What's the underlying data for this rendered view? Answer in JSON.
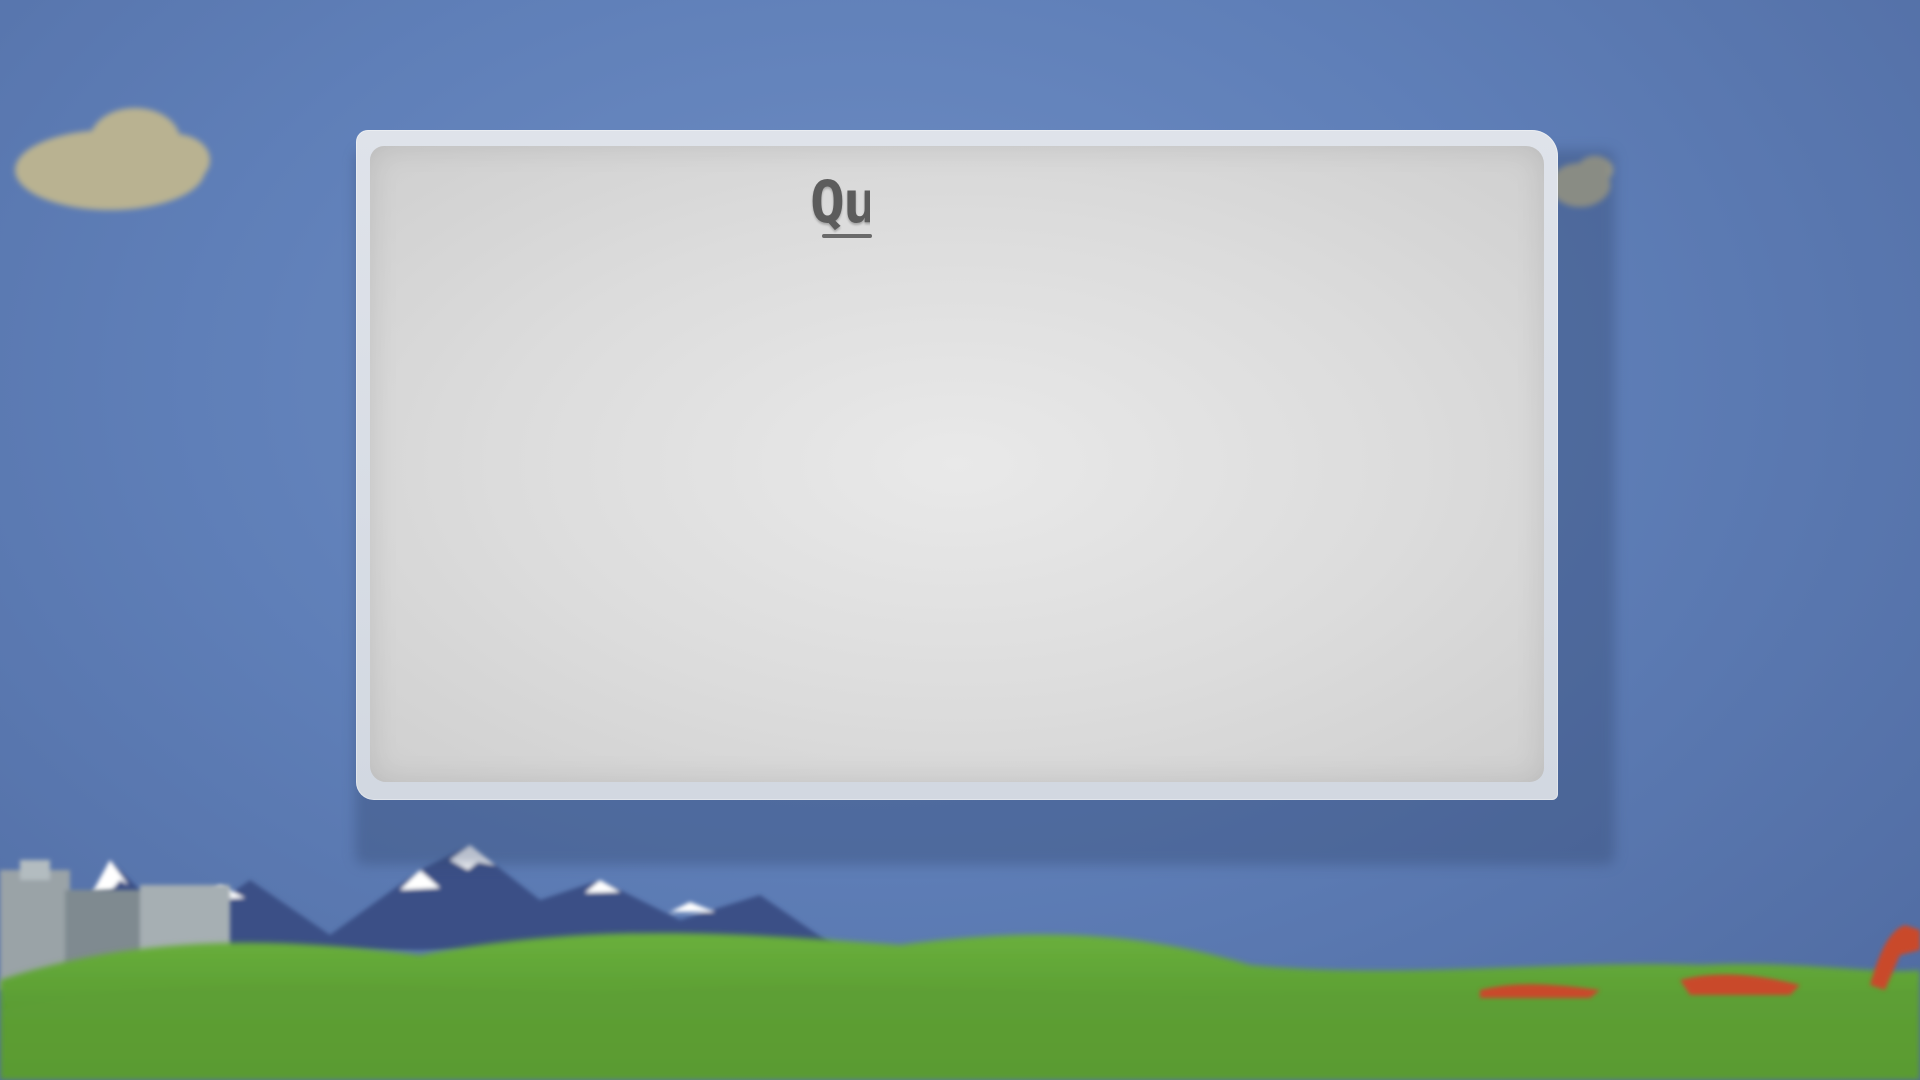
{
  "card": {
    "title": "Qu"
  },
  "colors": {
    "sky": "#5f7fb8",
    "card": "#dcdcdc",
    "grass": "#5a9a32",
    "mountains": "#3b4f86",
    "cloud": "#b8b08a"
  }
}
